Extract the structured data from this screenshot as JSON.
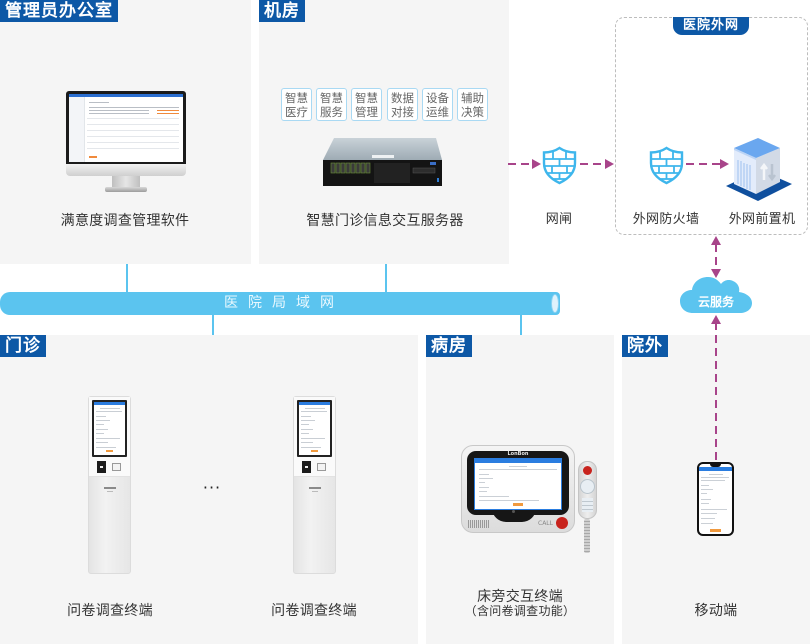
{
  "zones": {
    "admin_office": {
      "label": "管理员办公室",
      "device_caption": "满意度调查管理软件"
    },
    "server_room": {
      "label": "机房",
      "modules": [
        {
          "line1": "智慧",
          "line2": "医疗"
        },
        {
          "line1": "智慧",
          "line2": "服务"
        },
        {
          "line1": "智慧",
          "line2": "管理"
        },
        {
          "line1": "数据",
          "line2": "对接"
        },
        {
          "line1": "设备",
          "line2": "运维"
        },
        {
          "line1": "辅助",
          "line2": "决策"
        }
      ],
      "device_caption": "智慧门诊信息交互服务器"
    },
    "outpatient": {
      "label": "门诊",
      "devices": [
        {
          "caption": "问卷调查终端"
        },
        {
          "caption": "问卷调查终端"
        }
      ],
      "ellipsis": "···"
    },
    "ward": {
      "label": "病房",
      "device_caption": "床旁交互终端",
      "device_subcaption": "（含问卷调查功能）",
      "device_brand": "LonBon",
      "call_label": "CALL"
    },
    "outside": {
      "label": "院外",
      "device_caption": "移动端"
    }
  },
  "network": {
    "lan_label": "医院局域网",
    "gateway_label": "网闸",
    "extranet": {
      "label": "医院外网",
      "firewall_label": "外网防火墙",
      "frontend_label": "外网前置机"
    },
    "cloud_label": "云服务"
  },
  "colors": {
    "zone_tag": "#0d58a6",
    "panel_bg": "#f5f5f5",
    "lan": "#5bc4ef",
    "arrow": "#a8448a",
    "shield": "#3eb6ec"
  }
}
